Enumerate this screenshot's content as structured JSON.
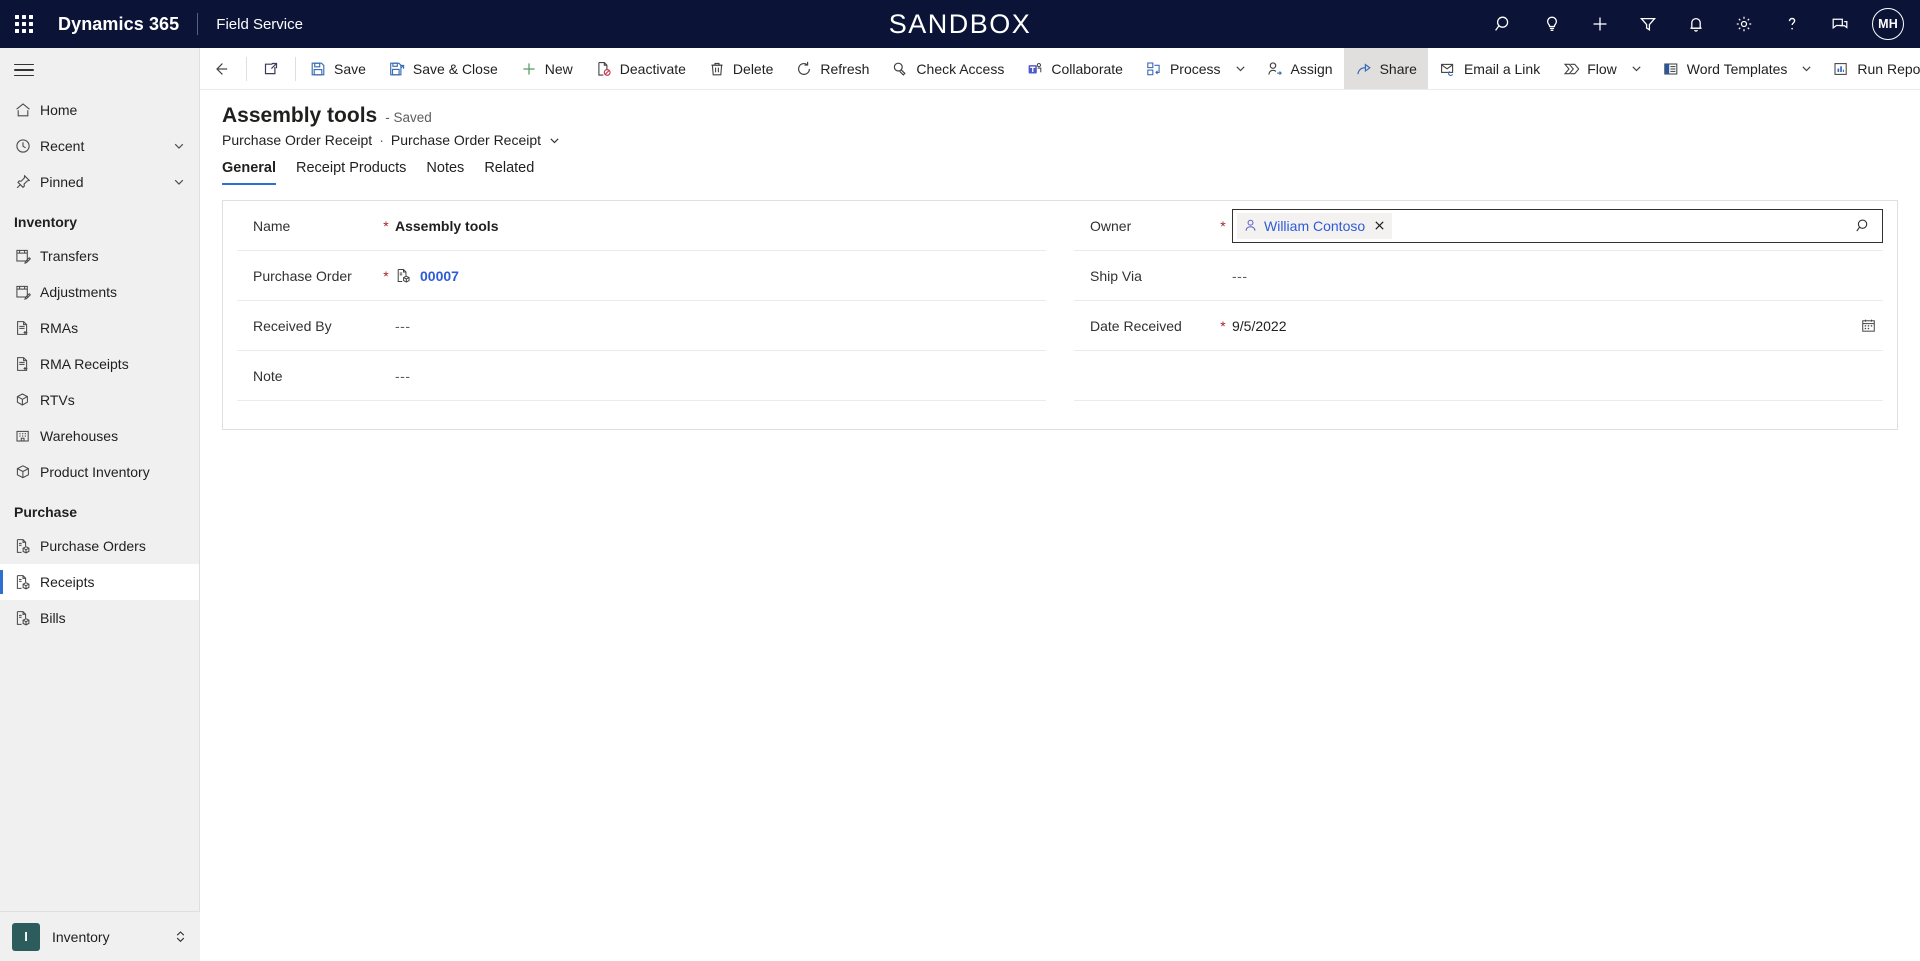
{
  "topbar": {
    "waffle_icon": "app-launcher-icon",
    "brand": "Dynamics 365",
    "app_name": "Field Service",
    "environment_label": "SANDBOX",
    "actions": [
      {
        "name": "search-icon",
        "label": "Search"
      },
      {
        "name": "lightbulb-icon",
        "label": "Insights"
      },
      {
        "name": "plus-icon",
        "label": "New"
      },
      {
        "name": "filter-icon",
        "label": "Filter"
      },
      {
        "name": "bell-icon",
        "label": "Notifications"
      },
      {
        "name": "gear-icon",
        "label": "Settings"
      },
      {
        "name": "question-icon",
        "label": "Help"
      },
      {
        "name": "feedback-icon",
        "label": "Feedback"
      }
    ],
    "avatar_initials": "MH"
  },
  "sidebar": {
    "toggle_icon": "hamburger-icon",
    "items": [
      {
        "label": "Home",
        "icon": "home-icon",
        "chevron": false,
        "selected": false
      },
      {
        "label": "Recent",
        "icon": "clock-icon",
        "chevron": true,
        "selected": false
      },
      {
        "label": "Pinned",
        "icon": "pin-icon",
        "chevron": true,
        "selected": false
      }
    ],
    "groups": [
      {
        "title": "Inventory",
        "items": [
          {
            "label": "Transfers",
            "icon": "transfer-icon",
            "selected": false
          },
          {
            "label": "Adjustments",
            "icon": "adjustment-icon",
            "selected": false
          },
          {
            "label": "RMAs",
            "icon": "rma-icon",
            "selected": false
          },
          {
            "label": "RMA Receipts",
            "icon": "rma-receipt-icon",
            "selected": false
          },
          {
            "label": "RTVs",
            "icon": "rtv-icon",
            "selected": false
          },
          {
            "label": "Warehouses",
            "icon": "warehouse-icon",
            "selected": false
          },
          {
            "label": "Product Inventory",
            "icon": "product-inventory-icon",
            "selected": false
          }
        ]
      },
      {
        "title": "Purchase",
        "items": [
          {
            "label": "Purchase Orders",
            "icon": "purchase-order-icon",
            "selected": false
          },
          {
            "label": "Receipts",
            "icon": "receipt-icon",
            "selected": true
          },
          {
            "label": "Bills",
            "icon": "bill-icon",
            "selected": false
          }
        ]
      }
    ],
    "area_switcher": {
      "badge": "I",
      "label": "Inventory",
      "chevron_icon": "chevron-up-down-icon"
    }
  },
  "commandbar": {
    "back": {
      "label": "Back",
      "icon": "back-arrow-icon"
    },
    "popout": {
      "label": "Open in new window",
      "icon": "popout-icon"
    },
    "buttons": [
      {
        "label": "Save",
        "icon": "save-icon",
        "caret": false,
        "active": false
      },
      {
        "label": "Save & Close",
        "icon": "save-close-icon",
        "caret": false,
        "active": false
      },
      {
        "label": "New",
        "icon": "plus-icon",
        "caret": false,
        "active": false
      },
      {
        "label": "Deactivate",
        "icon": "deactivate-icon",
        "caret": false,
        "active": false
      },
      {
        "label": "Delete",
        "icon": "delete-icon",
        "caret": false,
        "active": false
      },
      {
        "label": "Refresh",
        "icon": "refresh-icon",
        "caret": false,
        "active": false
      },
      {
        "label": "Check Access",
        "icon": "check-access-icon",
        "caret": false,
        "active": false
      },
      {
        "label": "Collaborate",
        "icon": "teams-icon",
        "caret": false,
        "active": false
      },
      {
        "label": "Process",
        "icon": "process-icon",
        "caret": true,
        "active": false
      },
      {
        "label": "Assign",
        "icon": "assign-icon",
        "caret": false,
        "active": false
      },
      {
        "label": "Share",
        "icon": "share-icon",
        "caret": false,
        "active": true
      },
      {
        "label": "Email a Link",
        "icon": "email-link-icon",
        "caret": false,
        "active": false
      },
      {
        "label": "Flow",
        "icon": "flow-icon",
        "caret": true,
        "active": false
      },
      {
        "label": "Word Templates",
        "icon": "word-template-icon",
        "caret": true,
        "active": false
      },
      {
        "label": "Run Report",
        "icon": "run-report-icon",
        "caret": true,
        "active": false
      }
    ]
  },
  "page": {
    "title": "Assembly tools",
    "saved_state": "- Saved",
    "breadcrumb": {
      "entity": "Purchase Order Receipt",
      "separator": "·",
      "form": "Purchase Order Receipt",
      "caret_icon": "chevron-down-icon"
    },
    "tabs": [
      {
        "label": "General",
        "active": true
      },
      {
        "label": "Receipt Products",
        "active": false
      },
      {
        "label": "Notes",
        "active": false
      },
      {
        "label": "Related",
        "active": false
      }
    ]
  },
  "form": {
    "left_column": [
      {
        "label": "Name",
        "required": true,
        "value": "Assembly tools",
        "kind": "text-bold"
      },
      {
        "label": "Purchase Order",
        "required": true,
        "value": "00007",
        "kind": "lookup-link",
        "icon": "purchase-order-icon"
      },
      {
        "label": "Received By",
        "required": false,
        "value": "---",
        "kind": "empty"
      },
      {
        "label": "Note",
        "required": false,
        "value": "---",
        "kind": "empty"
      }
    ],
    "right_column": [
      {
        "label": "Owner",
        "required": true,
        "kind": "lookup-focused",
        "chip": {
          "name": "William Contoso",
          "person_icon": "person-icon",
          "remove_icon": "close-icon"
        },
        "search_icon": "search-icon"
      },
      {
        "label": "Ship Via",
        "required": false,
        "value": "---",
        "kind": "empty"
      },
      {
        "label": "Date Received",
        "required": true,
        "value": "9/5/2022",
        "kind": "date",
        "trail_icon": "calendar-icon"
      },
      {
        "label": "",
        "required": false,
        "value": "",
        "kind": "blank"
      }
    ]
  },
  "colors": {
    "topbar_bg": "#0b1437",
    "accent": "#2f6fd0",
    "link": "#2f5bd7",
    "required": "#a4262c",
    "sidebar_bg": "#f0f0f0",
    "area_badge": "#2d5c5c"
  }
}
